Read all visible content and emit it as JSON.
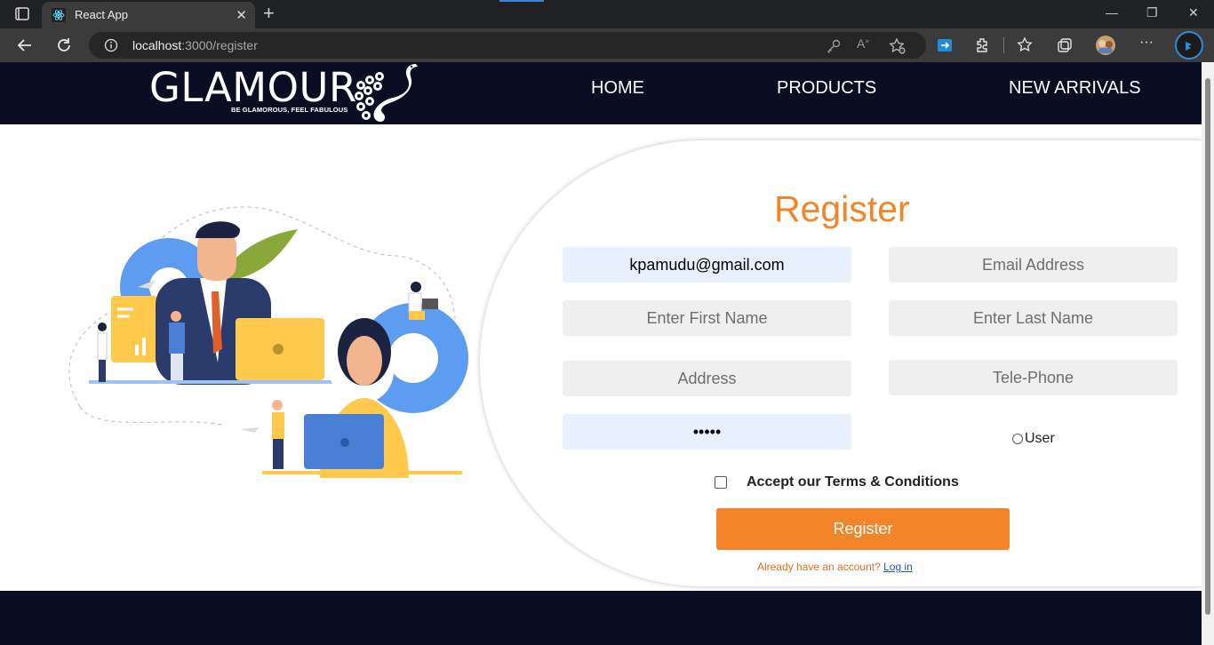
{
  "browser": {
    "tab_title": "React App",
    "url_host": "localhost",
    "url_path": ":3000/register"
  },
  "navbar": {
    "brand": "GLAMOUR",
    "tagline": "BE GLAMOROUS, FEEL FABULOUS",
    "links": [
      "HOME",
      "PRODUCTS",
      "NEW ARRIVALS"
    ]
  },
  "form": {
    "title": "Register",
    "email_value": "kpamudu@gmail.com",
    "email_placeholder": "Email Address",
    "first_name_placeholder": "Enter First Name",
    "last_name_placeholder": "Enter Last Name",
    "address_placeholder": "Address",
    "phone_placeholder": "Tele-Phone",
    "password_value": "12345",
    "radio_label": "User",
    "terms_label": "Accept our Terms & Conditions",
    "submit_label": "Register",
    "login_prompt": "Already have an account?",
    "login_link": "Log in"
  },
  "colors": {
    "accent": "#f3842a",
    "nav_bg": "#0b0e23",
    "link": "#1a52d6"
  }
}
